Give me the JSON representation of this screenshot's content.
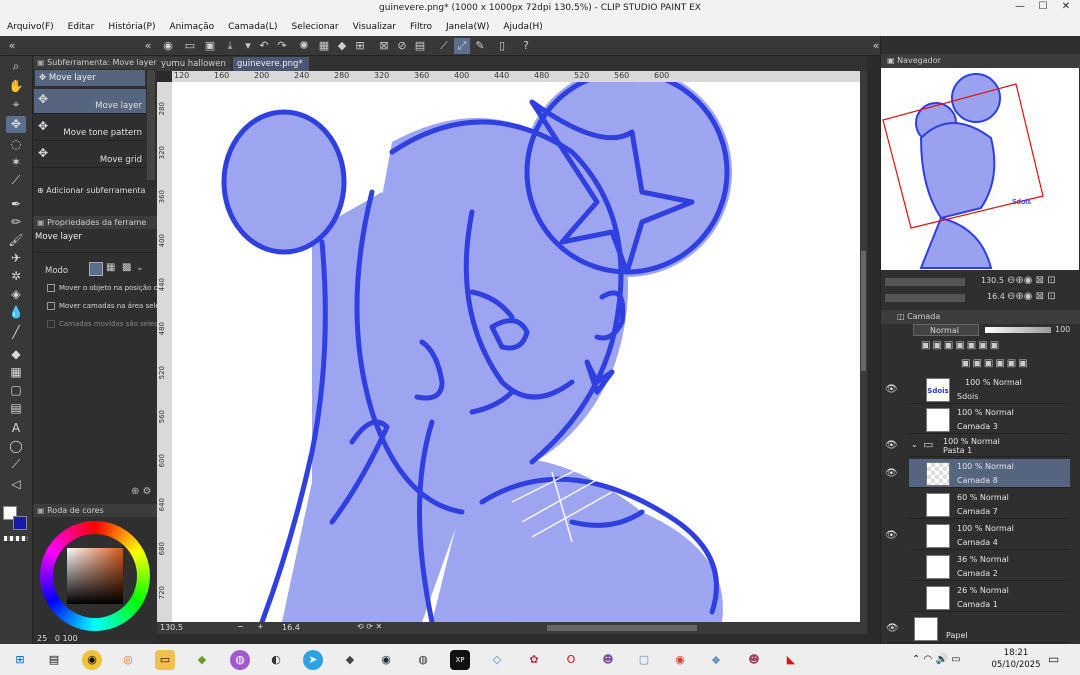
{
  "window": {
    "title": "guinevere.png* (1000 x 1000px 72dpi 130.5%) - CLIP STUDIO PAINT EX",
    "minimize": "—",
    "maximize": "☐",
    "close": "✕"
  },
  "menu": [
    "Arquivo(F)",
    "Editar",
    "História(P)",
    "Animação",
    "Camada(L)",
    "Selecionar",
    "Visualizar",
    "Filtro",
    "Janela(W)",
    "Ajuda(H)"
  ],
  "subtool": {
    "panel_title": "Subferramenta: Move layer",
    "header_item": "Move layer",
    "items": [
      "Move layer",
      "Move tone pattern",
      "Move grid"
    ],
    "add_label": "Adicionar subferramenta"
  },
  "toolprops": {
    "panel_title": "Propriedades da ferrame",
    "tool_name": "Move layer",
    "mode_label": "Modo",
    "option1": "Mover o objeto na posição clica",
    "option2": "Mover camadas na área seleci",
    "option3": "Camadas movidas são selecion"
  },
  "colorwheel": {
    "panel_title": "Roda de cores",
    "values": [
      "25",
      "0",
      "100"
    ]
  },
  "tabs": [
    "yumu hallowen",
    "guinevere.png*"
  ],
  "ruler_top": [
    "120",
    "160",
    "200",
    "240",
    "280",
    "320",
    "360",
    "400",
    "440",
    "480",
    "520",
    "560",
    "600"
  ],
  "ruler_left": [
    "280",
    "320",
    "360",
    "400",
    "440",
    "480",
    "520",
    "560",
    "600",
    "640",
    "680",
    "720"
  ],
  "status": {
    "zoom": "130.5",
    "angle": "16.4"
  },
  "navigator": {
    "panel_title": "Navegador",
    "zoom": "130.5",
    "angle": "16.4",
    "signature": "Sdois"
  },
  "layers": {
    "panel_title": "Camada",
    "blend_mode": "Normal",
    "opacity": "100",
    "rows": [
      {
        "pct": "100 % Normal",
        "name": "Sdois",
        "thumb": "Sdois"
      },
      {
        "pct": "100 % Normal",
        "name": "Camada 3",
        "thumb": ""
      },
      {
        "pct": "100 % Normal",
        "name": "Pasta 1",
        "thumb": "folder"
      },
      {
        "pct": "100 % Normal",
        "name": "Camada 8",
        "thumb": ""
      },
      {
        "pct": "60 % Normal",
        "name": "Camada 7",
        "thumb": ""
      },
      {
        "pct": "100 % Normal",
        "name": "Camada 4",
        "thumb": ""
      },
      {
        "pct": "36 % Normal",
        "name": "Camada 2",
        "thumb": ""
      },
      {
        "pct": "26 % Normal",
        "name": "Camada 1",
        "thumb": ""
      },
      {
        "pct": "",
        "name": "Papel",
        "thumb": ""
      }
    ]
  },
  "taskbar": {
    "time": "18:21",
    "date": "05/10/2025"
  },
  "colors": {
    "sketch_blue": "#2f3fe0",
    "fill_blue": "#8d95ee",
    "selected_row": "#56657f"
  }
}
